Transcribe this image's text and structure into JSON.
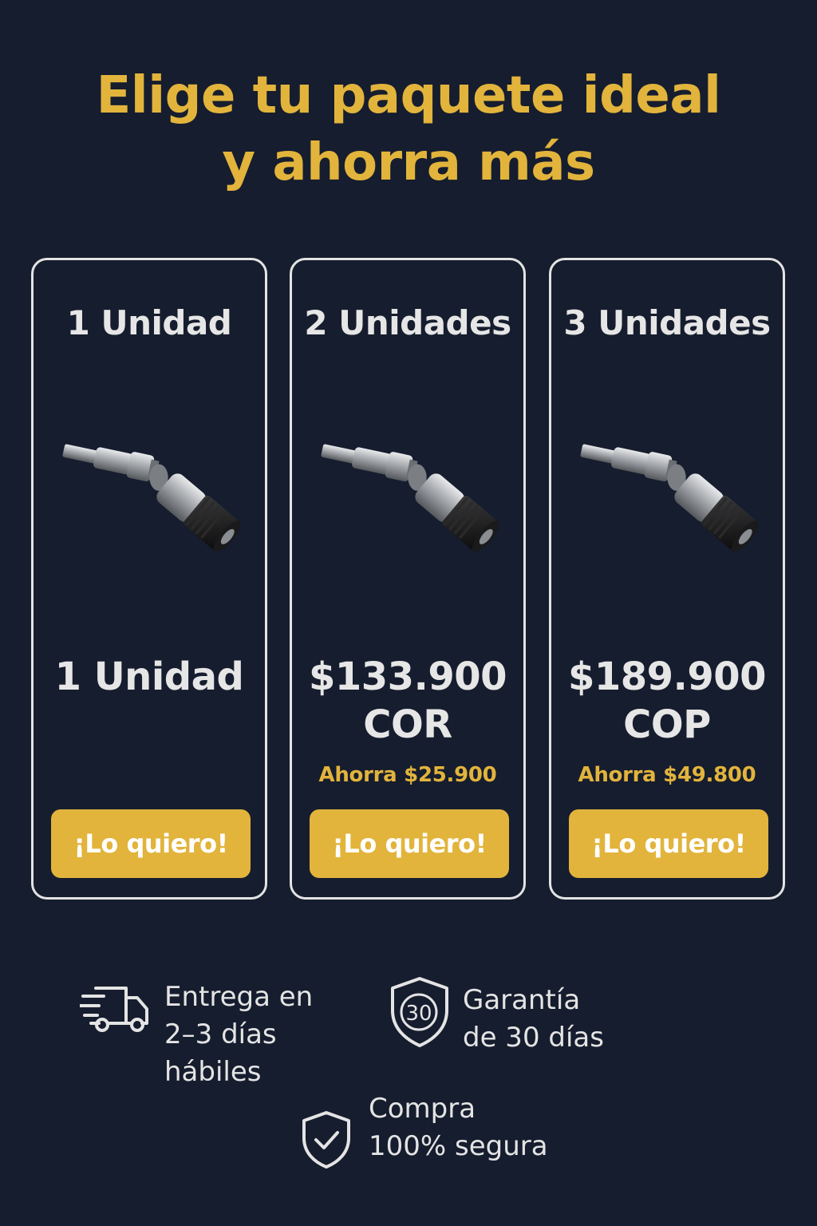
{
  "headline": {
    "line1": "Elige tu paquete ideal",
    "line2": "y ahorra más"
  },
  "packages": [
    {
      "title": "1 Unidad",
      "price_line1": "1 Unidad",
      "price_line2": "",
      "saving": "",
      "cta": "¡Lo quiero!"
    },
    {
      "title": "2 Unidades",
      "price_line1": "$133.900",
      "price_line2": "COR",
      "saving": "Ahorra $25.900",
      "cta": "¡Lo quiero!"
    },
    {
      "title": "3 Unidades",
      "price_line1": "$189.900",
      "price_line2": "COP",
      "saving": "Ahorra $49.800",
      "cta": "¡Lo quiero!"
    }
  ],
  "features": {
    "delivery": {
      "icon": "delivery-truck-icon",
      "line1": "Entrega en",
      "line2": "2–3 días",
      "line3": "hábiles"
    },
    "warranty": {
      "icon": "shield-30-icon",
      "badge": "30",
      "line1": "Garantía",
      "line2": "de 30 días"
    },
    "secure": {
      "icon": "shield-check-icon",
      "line1": "Compra",
      "line2": "100% segura"
    }
  },
  "colors": {
    "background": "#161d2e",
    "accent": "#e2b43c",
    "text": "#ececec",
    "card_border": "#e3e3e3"
  }
}
